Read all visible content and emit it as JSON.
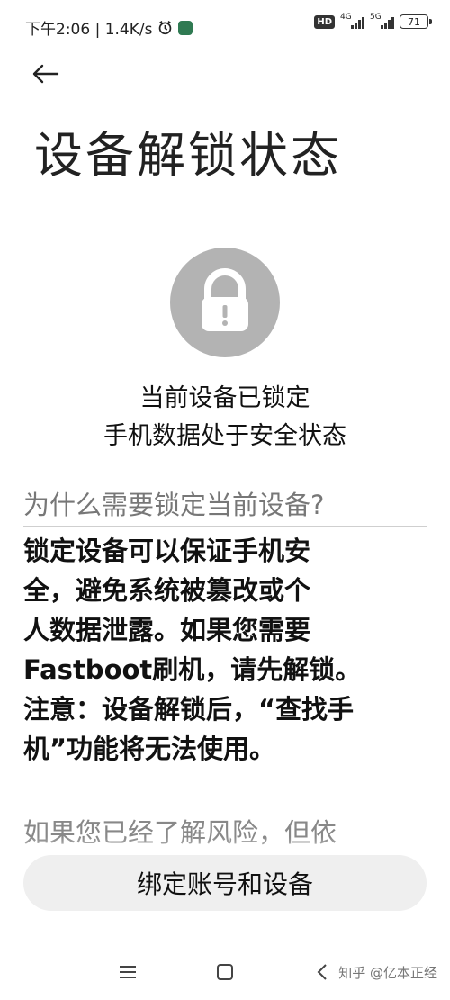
{
  "status_bar": {
    "time_text": "下午2:06 | 1.4K/s",
    "network_1": "4G",
    "network_2": "5G",
    "battery": "71",
    "hd_label": "HD"
  },
  "page": {
    "title": "设备解锁状态"
  },
  "lock_status": {
    "line1": "当前设备已锁定",
    "line2": "手机数据处于安全状态"
  },
  "question": {
    "title": "为什么需要锁定当前设备?"
  },
  "explanation": {
    "lines": [
      "锁定设备可以保证手机安",
      "全，避免系统被篡改或个",
      "人数据泄露。如果您需要",
      "Fastboot刷机，请先解锁。",
      "注意：设备解锁后，“查找手",
      "机”功能将无法使用。"
    ]
  },
  "risk_text": "如果您已经了解风险，但依",
  "buttons": {
    "bind_label": "绑定账号和设备"
  },
  "watermark": "知乎 @亿本正经",
  "colors": {
    "lock_circle": "#b3b3b3",
    "button_bg": "#efefef"
  }
}
